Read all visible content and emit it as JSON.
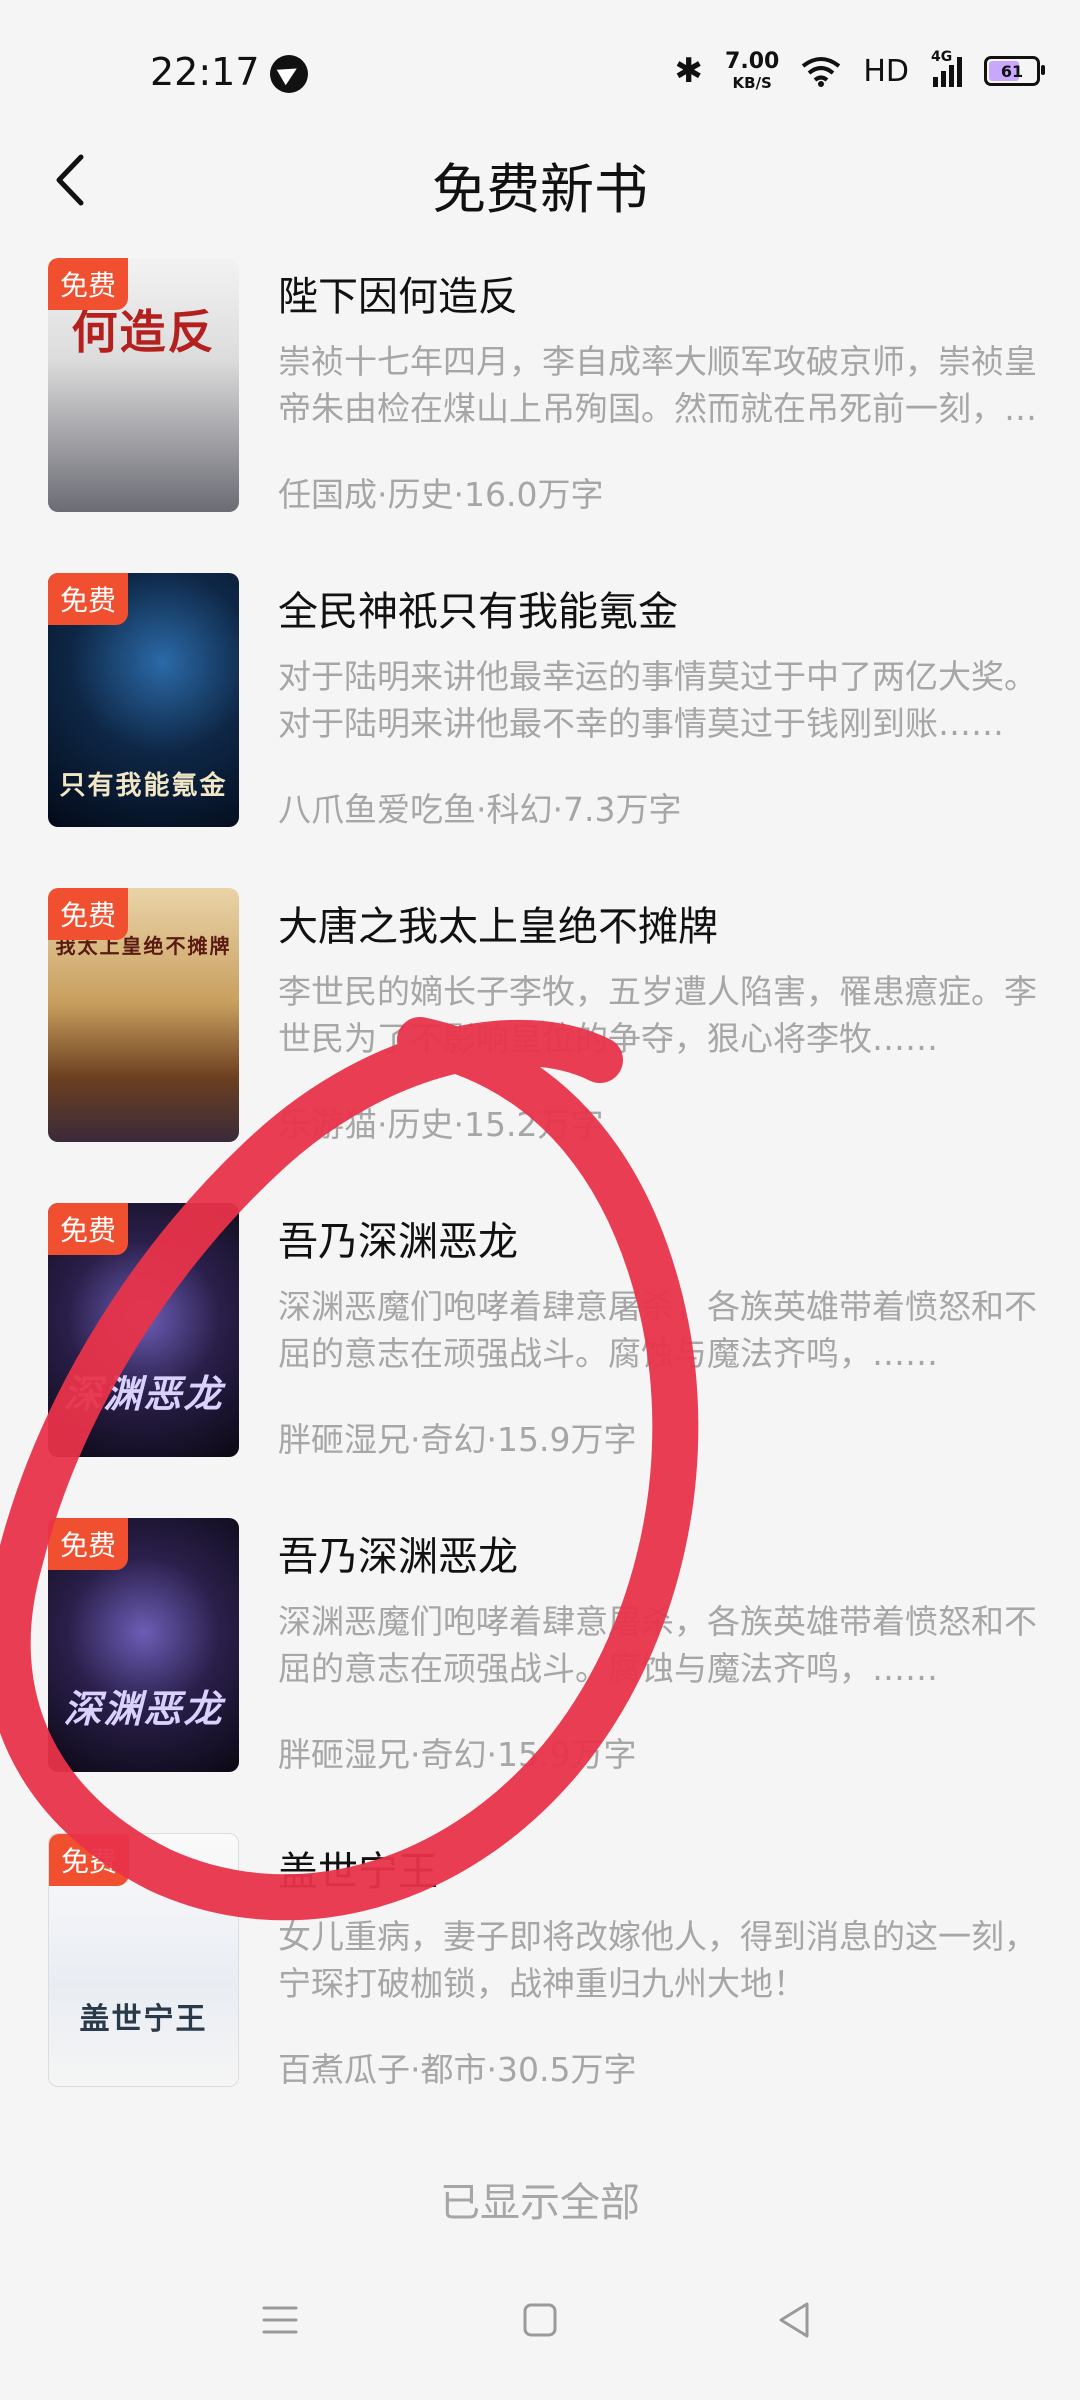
{
  "status_bar": {
    "time": "22:17",
    "speed_value": "7.00",
    "speed_unit": "KB/S",
    "hd": "HD",
    "network": "4G",
    "battery": "61"
  },
  "header": {
    "title": "免费新书"
  },
  "books": [
    {
      "badge": "免费",
      "cover_text": "何造反",
      "title": "陛下因何造反",
      "description": "崇祯十七年四月，李自成率大顺军攻破京师，崇祯皇帝朱由检在煤山上吊殉国。然而就在吊死前一刻，他的脑海中出现了一个声音……",
      "meta": "任国成·历史·16.0万字"
    },
    {
      "badge": "免费",
      "cover_text": "只有我能氪金",
      "title": "全民神祇只有我能氪金",
      "description": "对于陆明来讲他最幸运的事情莫过于中了两亿大奖。对于陆明来讲他最不幸的事情莫过于钱刚到账……",
      "meta": "八爪鱼爱吃鱼·科幻·7.3万字"
    },
    {
      "badge": "免费",
      "cover_text": "我太上皇绝不摊牌",
      "title": "大唐之我太上皇绝不摊牌",
      "description": "李世民的嫡长子李牧，五岁遭人陷害，罹患癔症。李世民为了不影响皇位的争夺，狠心将李牧……",
      "meta": "乐游猫·历史·15.2万字"
    },
    {
      "badge": "免费",
      "cover_text": "深渊恶龙",
      "title": "吾乃深渊恶龙",
      "description": "深渊恶魔们咆哮着肆意屠杀，各族英雄带着愤怒和不屈的意志在顽强战斗。腐蚀与魔法齐鸣，……",
      "meta": "胖砸湿兄·奇幻·15.9万字"
    },
    {
      "badge": "免费",
      "cover_text": "深渊恶龙",
      "title": "吾乃深渊恶龙",
      "description": "深渊恶魔们咆哮着肆意屠杀，各族英雄带着愤怒和不屈的意志在顽强战斗。腐蚀与魔法齐鸣，……",
      "meta": "胖砸湿兄·奇幻·15.9万字"
    },
    {
      "badge": "免费",
      "cover_text": "盖世宁王",
      "title": "盖世宁王",
      "description": "女儿重病，妻子即将改嫁他人，得到消息的这一刻，宁琛打破枷锁，战神重归九州大地！",
      "meta": "百煮瓜子·都市·30.5万字"
    }
  ],
  "footer": {
    "text": "已显示全部"
  },
  "colors": {
    "badge": "#f0502f",
    "annotation": "#e8334a",
    "muted_text": "#a6a6a6"
  }
}
